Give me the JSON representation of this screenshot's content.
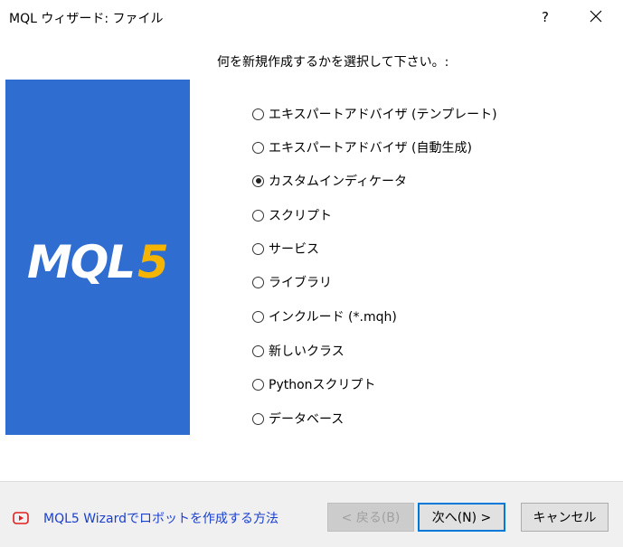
{
  "window": {
    "title": "MQL ウィザード: ファイル",
    "help_label": "?"
  },
  "prompt": "何を新規作成するかを選択して下さい。:",
  "logo": {
    "text_white": "MQL",
    "text_accent": "5",
    "background_color": "#2f6dd1",
    "accent_color": "#f5b400"
  },
  "options": [
    {
      "label": "エキスパートアドバイザ (テンプレート)",
      "checked": false
    },
    {
      "label": "エキスパートアドバイザ (自動生成)",
      "checked": false
    },
    {
      "label": "カスタムインディケータ",
      "checked": true
    },
    {
      "label": "スクリプト",
      "checked": false
    },
    {
      "label": "サービス",
      "checked": false
    },
    {
      "label": "ライブラリ",
      "checked": false
    },
    {
      "label": "インクルード (*.mqh)",
      "checked": false
    },
    {
      "label": "新しいクラス",
      "checked": false
    },
    {
      "label": "Pythonスクリプト",
      "checked": false
    },
    {
      "label": "データベース",
      "checked": false
    }
  ],
  "footer": {
    "help_link": "MQL5 Wizardでロボットを作成する方法",
    "back_label": "< 戻る(B)",
    "next_label": "次へ(N) >",
    "cancel_label": "キャンセル"
  }
}
